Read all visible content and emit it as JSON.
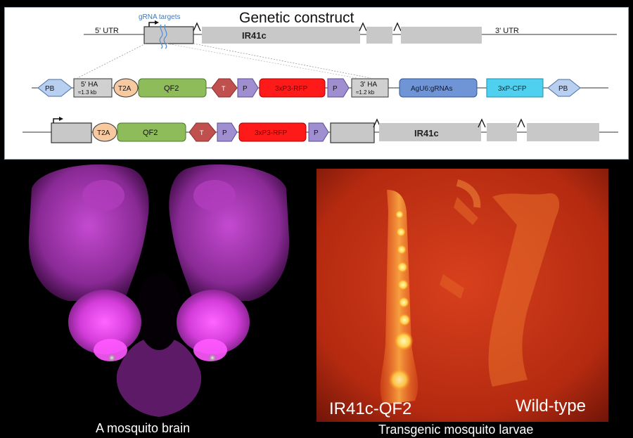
{
  "construct": {
    "title": "Genetic construct",
    "grna_targets": "gRNA targets",
    "row1": {
      "utr5": "5' UTR",
      "gene": "IR41c",
      "utr3": "3' UTR"
    },
    "row2": {
      "pb_left": "PB",
      "ha5_title": "5' HA",
      "ha5_size": "≈1.3 kb",
      "t2a": "T2A",
      "qf2": "QF2",
      "t": "T",
      "p1": "P",
      "rfp": "3xP3-RFP",
      "p2": "P",
      "ha3_title": "3' HA",
      "ha3_size": "≈1.2 kb",
      "grnas": "AgU6:gRNAs",
      "cfp": "3xP-CFP",
      "pb_right": "PB"
    },
    "row3": {
      "t2a": "T2A",
      "qf2": "QF2",
      "t": "T",
      "p1": "P",
      "rfp": "3xP3-RFP",
      "p2": "P",
      "gene": "IR41c"
    },
    "colors": {
      "exon": "#c8c8c8",
      "qf2": "#8fbc5a",
      "t2a": "#f6c9a1",
      "terminator": "#c0504d",
      "promoter": "#a08fd0",
      "rfp": "#ff1a1a",
      "grnas": "#6f95d6",
      "cfp": "#4fd0ef",
      "pb": "#b9cff0"
    }
  },
  "images": {
    "brain_caption": "A mosquito brain",
    "larvae_caption": "Transgenic mosquito larvae",
    "larvae_label_left": "IR41c-QF2",
    "larvae_label_right": "Wild-type"
  }
}
